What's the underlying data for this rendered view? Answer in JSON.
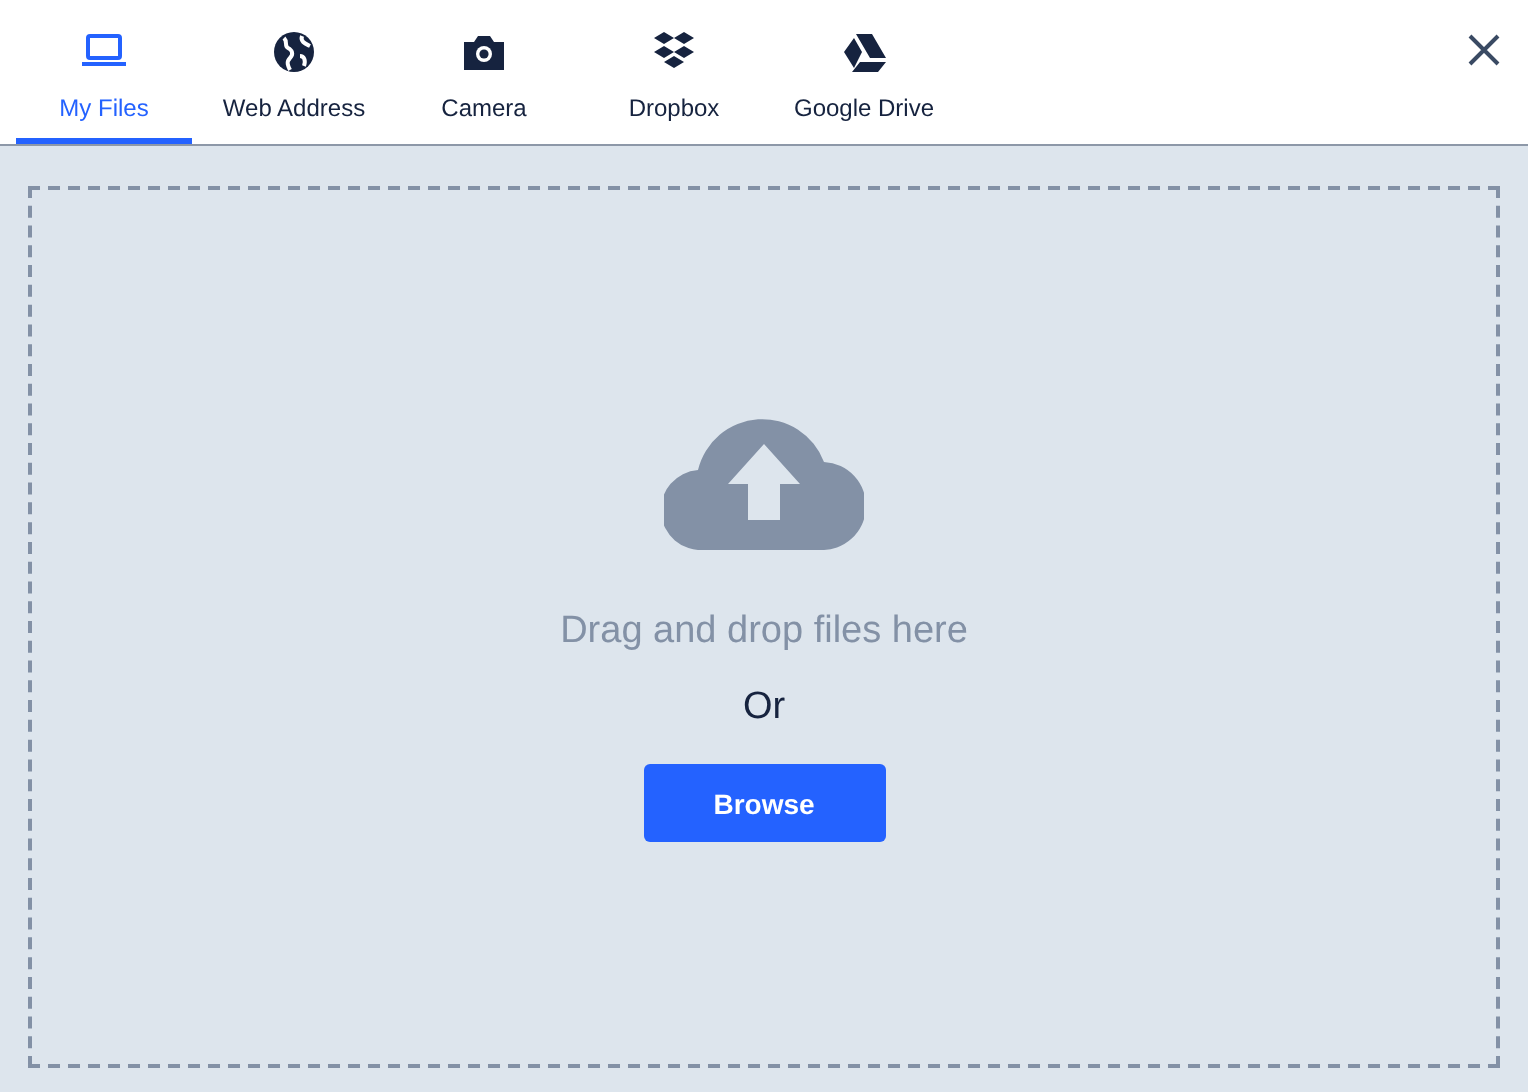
{
  "tabs": [
    {
      "kind": "laptop",
      "label": "My Files",
      "selected": true
    },
    {
      "kind": "globe",
      "label": "Web Address",
      "selected": false
    },
    {
      "kind": "camera",
      "label": "Camera",
      "selected": false
    },
    {
      "kind": "dropbox",
      "label": "Dropbox",
      "selected": false
    },
    {
      "kind": "drive",
      "label": "Google Drive",
      "selected": false
    }
  ],
  "dropzone": {
    "message": "Drag and drop files here",
    "separator": "Or",
    "button": "Browse"
  }
}
